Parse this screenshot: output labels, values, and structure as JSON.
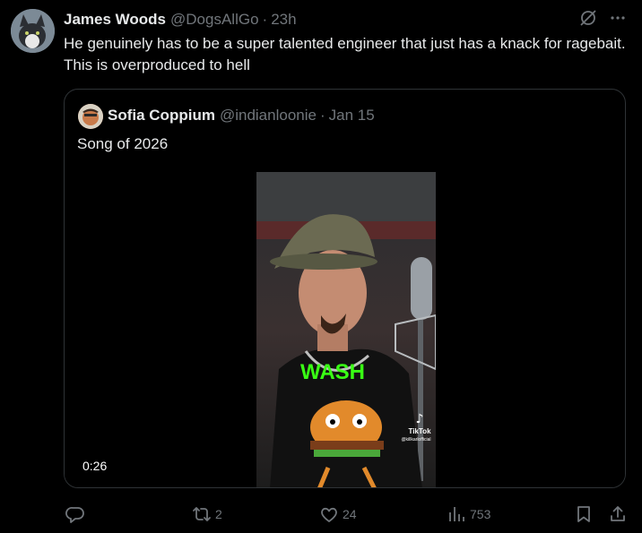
{
  "post": {
    "author": {
      "name": "James Woods",
      "handle": "@DogsAllGo",
      "separator": "·",
      "time": "23h"
    },
    "text": "He genuinely has to be a super talented engineer that just has a knack for ragebait. This is overproduced to hell",
    "header_icons": [
      "grok-icon",
      "more-icon"
    ]
  },
  "quoted_post": {
    "author": {
      "name": "Sofia Coppium",
      "handle": "@indianloonie",
      "separator": "·",
      "date": "Jan 15"
    },
    "text": "Song of 2026",
    "video": {
      "duration": "0:26",
      "overlay_text": "WASH",
      "watermark": "TikTok",
      "watermark_handle": "@killkarlofficial"
    }
  },
  "actions": {
    "reply": {
      "icon": "reply-icon",
      "count": ""
    },
    "repost": {
      "icon": "repost-icon",
      "count": "2"
    },
    "like": {
      "icon": "like-icon",
      "count": "24"
    },
    "views": {
      "icon": "views-icon",
      "count": "753"
    },
    "bookmark": {
      "icon": "bookmark-icon"
    },
    "share": {
      "icon": "share-icon"
    }
  },
  "colors": {
    "background": "#000000",
    "text": "#e7e9ea",
    "secondary": "#71767b",
    "border": "#2f3336",
    "neon": "#39ff14"
  }
}
